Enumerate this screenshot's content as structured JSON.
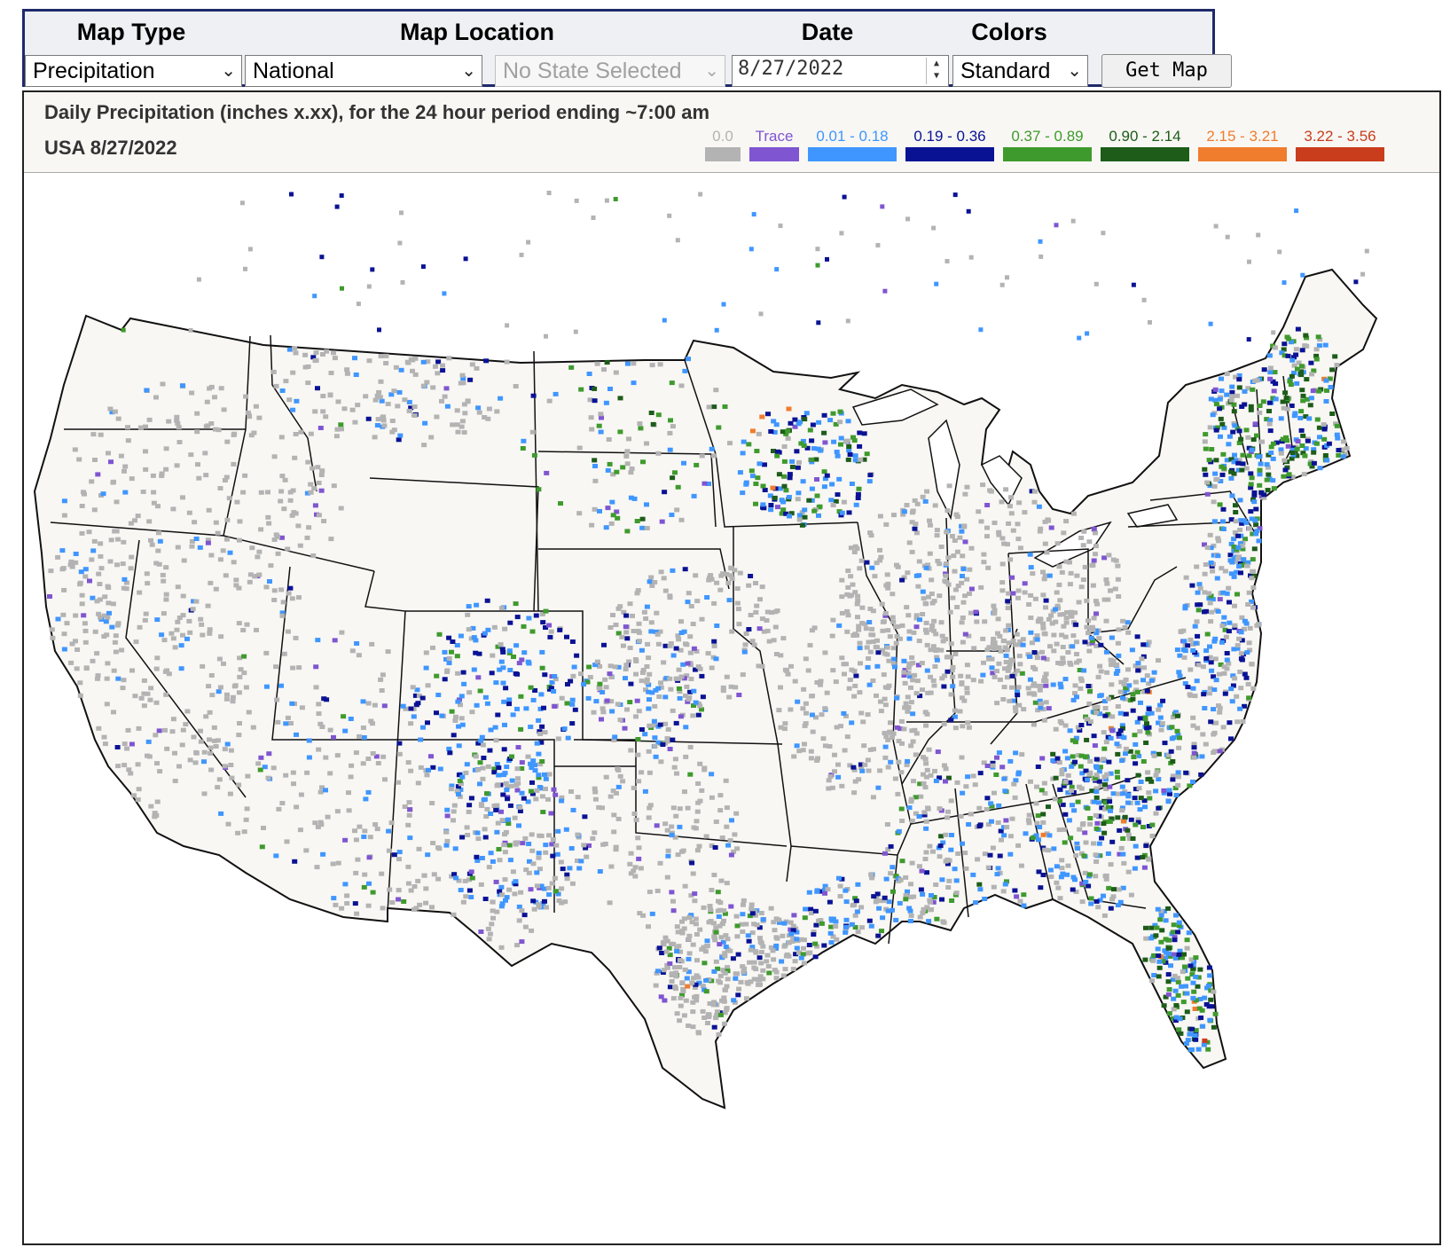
{
  "controls": {
    "headers": {
      "map_type": "Map Type",
      "map_location": "Map Location",
      "date": "Date",
      "colors": "Colors"
    },
    "map_type_value": "Precipitation",
    "map_location_value": "National",
    "state_value": "No State Selected",
    "date_value": "8/27/2022",
    "colors_value": "Standard",
    "get_map_label": "Get Map"
  },
  "map": {
    "title": "Daily Precipitation (inches  x.xx),  for the 24 hour period ending ~7:00 am",
    "subtitle": "USA 8/27/2022",
    "legend": [
      {
        "label": "0.0",
        "color": "#b3b3b3"
      },
      {
        "label": "Trace",
        "color": "#7f55d1"
      },
      {
        "label": "0.01 - 0.18",
        "color": "#3f96ff"
      },
      {
        "label": "0.19 - 0.36",
        "color": "#0a1294"
      },
      {
        "label": "0.37 - 0.89",
        "color": "#3f9a2d"
      },
      {
        "label": "0.90 - 2.14",
        "color": "#1d5c19"
      },
      {
        "label": "2.15 - 3.21",
        "color": "#f07c2e"
      },
      {
        "label": "3.22 - 3.56",
        "color": "#c93c1c"
      }
    ],
    "land_color": "#f8f7f4",
    "border_color": "#111111"
  }
}
